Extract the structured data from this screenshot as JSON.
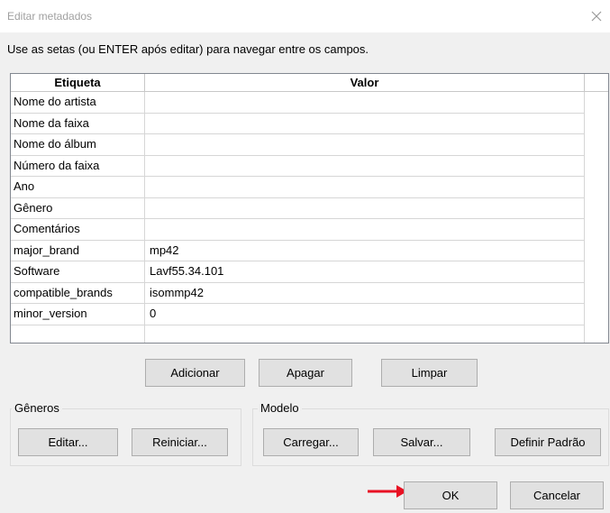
{
  "window": {
    "title": "Editar metadados"
  },
  "instructions": "Use as setas (ou ENTER após editar) para navegar entre os campos.",
  "grid": {
    "headers": {
      "label": "Etiqueta",
      "value": "Valor"
    },
    "rows": [
      {
        "label": "Nome do artista",
        "value": ""
      },
      {
        "label": "Nome da faixa",
        "value": ""
      },
      {
        "label": "Nome do álbum",
        "value": ""
      },
      {
        "label": "Número da faixa",
        "value": ""
      },
      {
        "label": "Ano",
        "value": ""
      },
      {
        "label": "Gênero",
        "value": ""
      },
      {
        "label": "Comentários",
        "value": ""
      },
      {
        "label": "major_brand",
        "value": "mp42"
      },
      {
        "label": "Software",
        "value": "Lavf55.34.101"
      },
      {
        "label": "compatible_brands",
        "value": "isommp42"
      },
      {
        "label": "minor_version",
        "value": "0"
      },
      {
        "label": "",
        "value": ""
      }
    ]
  },
  "actions": {
    "add": "Adicionar",
    "delete": "Apagar",
    "clear": "Limpar"
  },
  "genres_group": {
    "title": "Gêneros",
    "edit": "Editar...",
    "reset": "Reiniciar..."
  },
  "template_group": {
    "title": "Modelo",
    "load": "Carregar...",
    "save": "Salvar...",
    "set_default": "Definir Padrão"
  },
  "dialog": {
    "ok": "OK",
    "cancel": "Cancelar"
  },
  "colors": {
    "accent_arrow": "#e81123",
    "button_bg": "#e1e1e1",
    "button_border": "#adadad",
    "window_bg": "#f0f0f0"
  }
}
